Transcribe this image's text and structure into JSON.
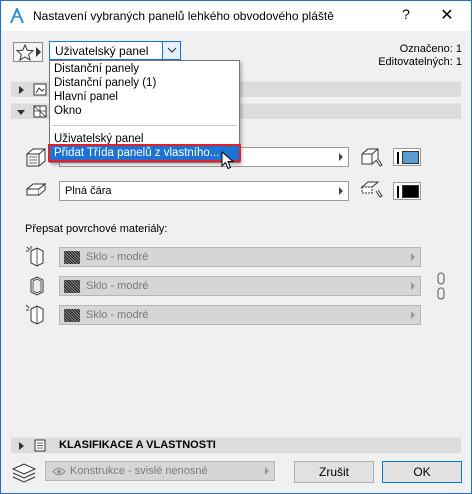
{
  "window": {
    "title": "Nastavení vybraných panelů lehkého obvodového pláště",
    "help_label": "?",
    "close_label": "✕"
  },
  "favorites": {
    "icon": "star-icon"
  },
  "panel_combo": {
    "value": "Uživatelský panel"
  },
  "selection_info": {
    "selected_line": "Označeno: 1",
    "editable_line": "Editovatelných: 1"
  },
  "dropdown": {
    "items": [
      "Distanční panely",
      "Distanční panely (1)",
      "Hlavní panel",
      "Okno"
    ],
    "items_after_separator": [
      "Uživatelský panel",
      "Přidat Třída panelů z vlastního..."
    ],
    "highlighted_index": 1
  },
  "sections": {
    "classification_label": "KLASIFIKACE A VLASTNOSTI"
  },
  "line_field": {
    "value": "Plná čára"
  },
  "override_label": "Přepsat povrchové materiály:",
  "materials": [
    "Sklo - modré",
    "Sklo - modré",
    "Sklo - modré"
  ],
  "colors": {
    "accent": "#1e73d2",
    "highlight_border": "#e0202a",
    "swatch_blue": "#5b9bd5"
  },
  "bottom": {
    "layer_value": "Konstrukce - svislé nenosné",
    "cancel_label": "Zrušit",
    "ok_label": "OK"
  }
}
